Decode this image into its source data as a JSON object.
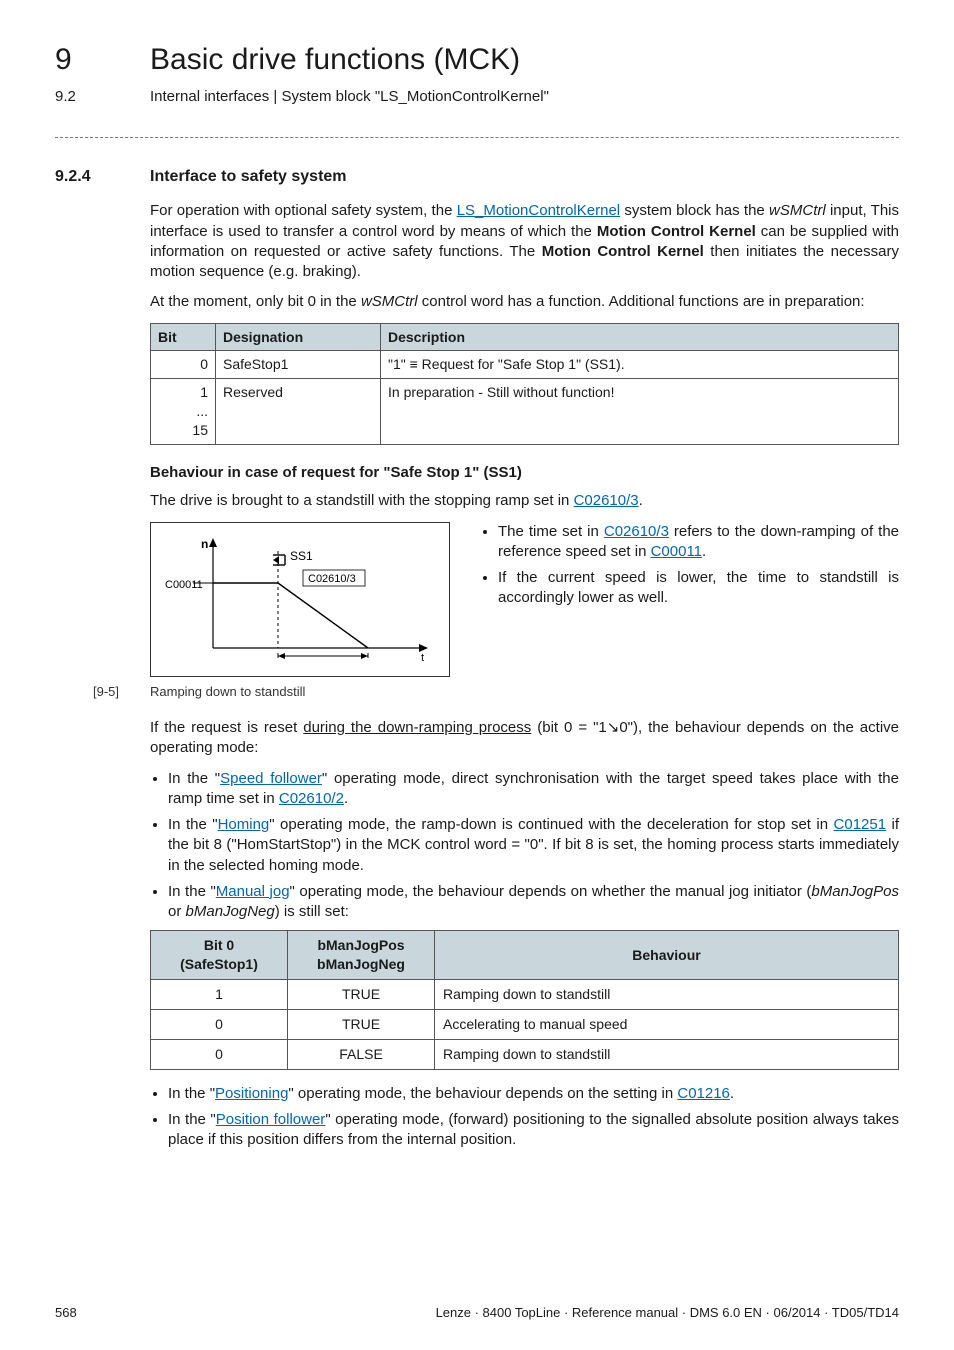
{
  "header": {
    "chapter_num": "9",
    "chapter_title": "Basic drive functions (MCK)",
    "section_num": "9.2",
    "section_title": "Internal interfaces | System block \"LS_MotionControlKernel\""
  },
  "section": {
    "num": "9.2.4",
    "title": "Interface to safety system"
  },
  "para1_a": "For operation with optional safety system, the ",
  "para1_link": "LS_MotionControlKernel",
  "para1_b": " system block has the ",
  "para1_em1": "wSMCtrl",
  "para1_c": " input, This interface is used to transfer a control word by means of which the ",
  "para1_bold1": "Motion Control Kernel",
  "para1_d": " can be supplied with information on requested or active safety functions. The ",
  "para1_bold2": "Motion Control Kernel",
  "para1_e": " then initiates the necessary motion sequence (e.g. braking).",
  "para2_a": "At the moment, only bit 0 in the ",
  "para2_em1": "wSMCtrl",
  "para2_b": " control word has a function. Additional functions are in preparation:",
  "bits_table": {
    "head": {
      "c1": "Bit",
      "c2": "Designation",
      "c3": "Description"
    },
    "rows": [
      {
        "bit": "0",
        "desig": "SafeStop1",
        "desc": "\"1\" ≡ Request for \"Safe Stop 1\" (SS1)."
      },
      {
        "bit": "1\n...\n15",
        "desig": "Reserved",
        "desc": "In preparation - Still without function!"
      }
    ]
  },
  "sub_heading": "Behaviour in case of request for \"Safe Stop 1\" (SS1)",
  "para3_a": "The drive is brought to a standstill with the stopping ramp set in ",
  "para3_link": "C02610/3",
  "para3_b": ".",
  "figure": {
    "label_n": "n",
    "label_C00011": "C00011",
    "label_ss1": "SS1",
    "label_ramp": "C02610/3",
    "axis_t": "t"
  },
  "fig_bullets": {
    "b1_a": "The time set in ",
    "b1_link1": "C02610/3",
    "b1_b": " refers to the down-ramping of the reference speed set in ",
    "b1_link2": "C00011",
    "b1_c": ".",
    "b2": "If the current speed is lower, the time to standstill is accordingly lower as well."
  },
  "caption": {
    "num": "[9-5]",
    "text": "Ramping down to standstill"
  },
  "para4_a": "If the request is reset ",
  "para4_u": "during the down-ramping process",
  "para4_b": " (bit 0 = \"1↘0\"), the behaviour depends on the active operating mode:",
  "bullets": {
    "i1_a": "In the \"",
    "i1_link": "Speed follower",
    "i1_b": "\" operating mode, direct synchronisation with the target speed takes place with the ramp time set in ",
    "i1_link2": "C02610/2",
    "i1_c": ".",
    "i2_a": "In the \"",
    "i2_link": "Homing",
    "i2_b": "\" operating mode, the ramp-down is continued with the deceleration for stop set in ",
    "i2_link2": "C01251",
    "i2_c": " if the bit 8 (\"HomStartStop\") in the MCK control word = \"0\". If bit 8 is set, the homing process starts immediately in the selected homing mode.",
    "i3_a": "In the \"",
    "i3_link": "Manual jog",
    "i3_b": "\" operating mode, the behaviour depends on whether the manual jog initiator (",
    "i3_em1": "bManJogPos",
    "i3_or": " or ",
    "i3_em2": "bManJogNeg",
    "i3_c": ") is still set:"
  },
  "behav_table": {
    "head": {
      "c1": "Bit 0\n(SafeStop1)",
      "c2": "bManJogPos\nbManJogNeg",
      "c3": "Behaviour"
    },
    "rows": [
      {
        "b0": "1",
        "bm": "TRUE",
        "beh": "Ramping down to standstill"
      },
      {
        "b0": "0",
        "bm": "TRUE",
        "beh": "Accelerating to manual speed"
      },
      {
        "b0": "0",
        "bm": "FALSE",
        "beh": "Ramping down to standstill"
      }
    ]
  },
  "bullets2": {
    "i4_a": "In the \"",
    "i4_link": "Positioning",
    "i4_b": "\" operating mode, the behaviour depends on the setting in ",
    "i4_link2": "C01216",
    "i4_c": ".",
    "i5_a": "In the \"",
    "i5_link": "Position follower",
    "i5_b": "\" operating mode, (forward) positioning to the signalled absolute position always takes place if this position differs from the internal position."
  },
  "footer": {
    "page": "568",
    "right": "Lenze · 8400 TopLine · Reference manual · DMS 6.0 EN · 06/2014 · TD05/TD14"
  }
}
